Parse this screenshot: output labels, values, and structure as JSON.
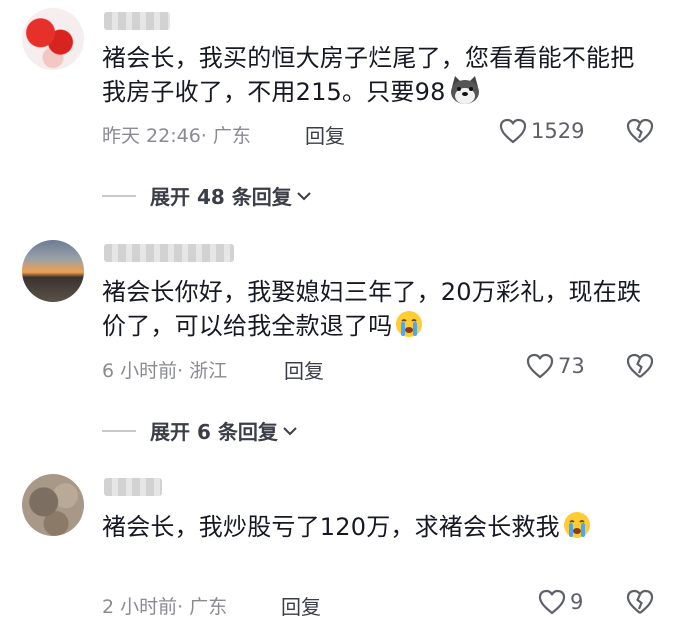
{
  "comments": [
    {
      "text": "褚会长，我买的恒大房子烂尾了，您看看能不能把我房子收了，不用215。只要98",
      "emoji": "dog-doge-emoji",
      "time": "昨天 22:46",
      "location": "· 广东",
      "reply_label": "回复",
      "likes": "1529",
      "expand_label": "展开 48 条回复"
    },
    {
      "text": "褚会长你好，我娶媳妇三年了，20万彩礼，现在跌价了，可以给我全款退了吗",
      "emoji": "crying-face-emoji",
      "time": "6 小时前",
      "location": "· 浙江",
      "reply_label": "回复",
      "likes": "73",
      "expand_label": "展开 6 条回复"
    },
    {
      "text": "褚会长，我炒股亏了120万，求褚会长救我",
      "emoji": "crying-face-emoji",
      "time": "2 小时前",
      "location": "· 广东",
      "reply_label": "回复",
      "likes": "9"
    }
  ],
  "colors": {
    "text_primary": "#161823",
    "text_meta": "#8a8b91",
    "icon": "#5e6068"
  }
}
